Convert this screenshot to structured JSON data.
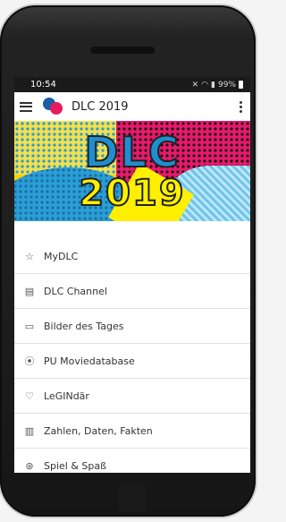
{
  "status": {
    "time": "10:54",
    "battery": "99%"
  },
  "appbar": {
    "title": "DLC 2019"
  },
  "banner": {
    "line1": "DLC",
    "line2": "2019"
  },
  "menu": {
    "items": [
      {
        "label": "MyDLC",
        "icon": "star-icon"
      },
      {
        "label": "DLC Channel",
        "icon": "channel-icon"
      },
      {
        "label": "Bilder des Tages",
        "icon": "folder-icon"
      },
      {
        "label": "PU Moviedatabase",
        "icon": "play-icon"
      },
      {
        "label": "LeGINdär",
        "icon": "heart-icon"
      },
      {
        "label": "Zahlen, Daten, Fakten",
        "icon": "bar-chart-icon"
      },
      {
        "label": "Spiel & Spaß",
        "icon": "ball-icon"
      }
    ]
  }
}
